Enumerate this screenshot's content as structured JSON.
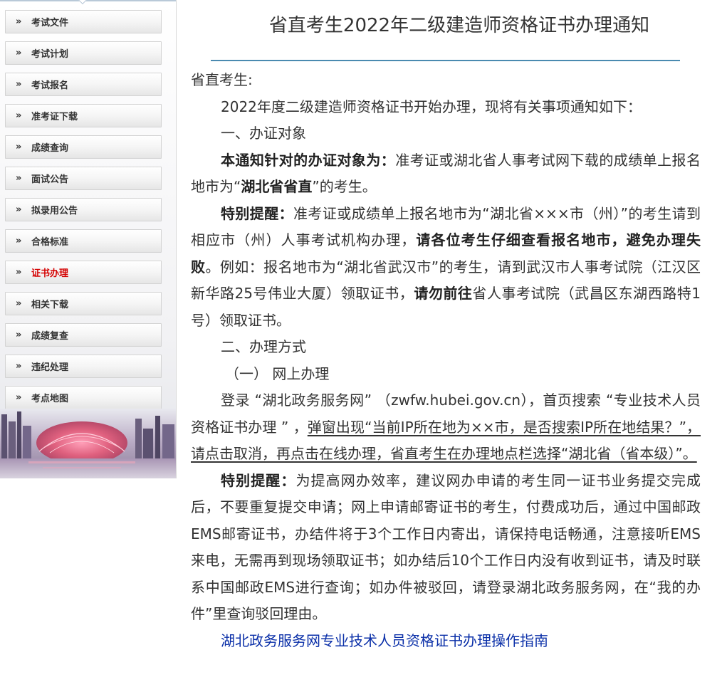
{
  "sidebar": {
    "items": [
      {
        "label": "考试文件",
        "active": false
      },
      {
        "label": "考试计划",
        "active": false
      },
      {
        "label": "考试报名",
        "active": false
      },
      {
        "label": "准考证下载",
        "active": false
      },
      {
        "label": "成绩查询",
        "active": false
      },
      {
        "label": "面试公告",
        "active": false
      },
      {
        "label": "拟录用公告",
        "active": false
      },
      {
        "label": "合格标准",
        "active": false
      },
      {
        "label": "证书办理",
        "active": true
      },
      {
        "label": "相关下载",
        "active": false
      },
      {
        "label": "成绩复查",
        "active": false
      },
      {
        "label": "违纪处理",
        "active": false
      },
      {
        "label": "考点地图",
        "active": false
      }
    ],
    "arrow_glyph": "»"
  },
  "article": {
    "title": "省直考生2022年二级建造师资格证书办理通知",
    "greeting": "省直考生:",
    "intro": "2022年度二级建造师资格证书开始办理，现将有关事项通知如下：",
    "sec1_heading": "一、办证对象",
    "p1": {
      "b1": "本通知针对的办证对象为：",
      "t1": "准考证或湖北省人事考试网下载的成绩单上报名地市为“",
      "b2": "湖北省省直",
      "t2": "”的考生。"
    },
    "p2": {
      "b1": "特别提醒：",
      "t1": "准考证或成绩单上报名地市为“湖北省×××市（州）”的考生请到相应市（州）人事考试机构办理，",
      "b2": "请各位考生仔细查看报名地市，避免办理失败",
      "t2": "。例如：报名地市为“湖北省武汉市”的考生，请到武汉市人事考试院（江汉区新华路25号伟业大厦）领取证书，",
      "b3": "请勿前往",
      "t3": "省人事考试院（武昌区东湖西路特1号）领取证书。"
    },
    "sec2_heading": "二、办理方式",
    "sub1_heading": "（一） 网上办理",
    "p3": {
      "t1": "登录 “湖北政务服务网” （zwfw.hubei.gov.cn），首页搜索 “专业技术人员资格证书办理 ” ，",
      "u1": "弹窗出现“当前IP所在地为××市，是否搜索IP所在地结果？”，请点击取消，再点击在线办理，省直考生在办理地点栏选择“湖北省（省本级）”。"
    },
    "p4": {
      "b1": "特别提醒：",
      "t1": "为提高网办效率，建议网办申请的考生同一证书业务提交完成后，不要重复提交申请；网上申请邮寄证书的考生，付费成功后，通过中国邮政EMS邮寄证书，办结件将于3个工作日内寄出，请保持电话畅通，注意接听EMS来电，无需再到现场领取证书；如办结后10个工作日内没有收到证书，请及时联系中国邮政EMS进行查询；如办件被驳回，请登录湖北政务服务网，在“我的办件”里查询驳回理由。"
    },
    "guide_link": "湖北政务服务网专业技术人员资格证书办理操作指南"
  },
  "colors": {
    "active_menu": "#d40000",
    "title_rule": "#4a8ab0",
    "link": "#0a2fa8"
  }
}
